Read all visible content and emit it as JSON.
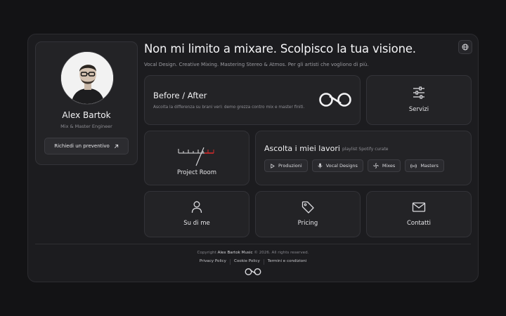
{
  "profile": {
    "name": "Alex Bartok",
    "role": "Mix & Master Engineer",
    "cta_label": "Richiedi un preventivo",
    "cta_icon": "arrow-up-right-icon"
  },
  "header": {
    "headline": "Non mi limito a mixare. Scolpisco la tua visione.",
    "subline": "Vocal Design. Creative Mixing. Mastering Stereo & Atmos. Per gli artisti che vogliono di più.",
    "language_icon": "globe-icon"
  },
  "before_after": {
    "title": "Before / After",
    "description": "Ascolta la differenza su brani veri: demo grezza contro mix e master finiti.",
    "logo_icon": "infinity-logo-icon"
  },
  "servizi": {
    "label": "Servizi",
    "icon": "sliders-icon"
  },
  "project_room": {
    "label": "Project Room",
    "icon": "vu-meter-icon"
  },
  "listen": {
    "title": "Ascolta i miei lavori",
    "subtitle": "playlist Spotify curate",
    "chips": [
      {
        "label": "Produzioni",
        "icon": "play-icon"
      },
      {
        "label": "Vocal Designs",
        "icon": "microphone-icon"
      },
      {
        "label": "Mixes",
        "icon": "fan-icon"
      },
      {
        "label": "Masters",
        "icon": "broadcast-icon"
      }
    ]
  },
  "su_di_me": {
    "label": "Su di me",
    "icon": "user-icon"
  },
  "pricing": {
    "label": "Pricing",
    "icon": "tag-icon"
  },
  "contatti": {
    "label": "Contatti",
    "icon": "mail-icon"
  },
  "footer": {
    "copyright_prefix": "Copyright",
    "copyright_brand": "Alex Bartok Music",
    "copyright_suffix": "© 2026. All rights reserved.",
    "links": [
      "Privacy Policy",
      "Cookie Policy",
      "Termini e condizioni"
    ]
  },
  "colors": {
    "background": "#131315",
    "panel": "#1c1c1f",
    "card": "#232326",
    "accent_red": "#d22b2b"
  }
}
